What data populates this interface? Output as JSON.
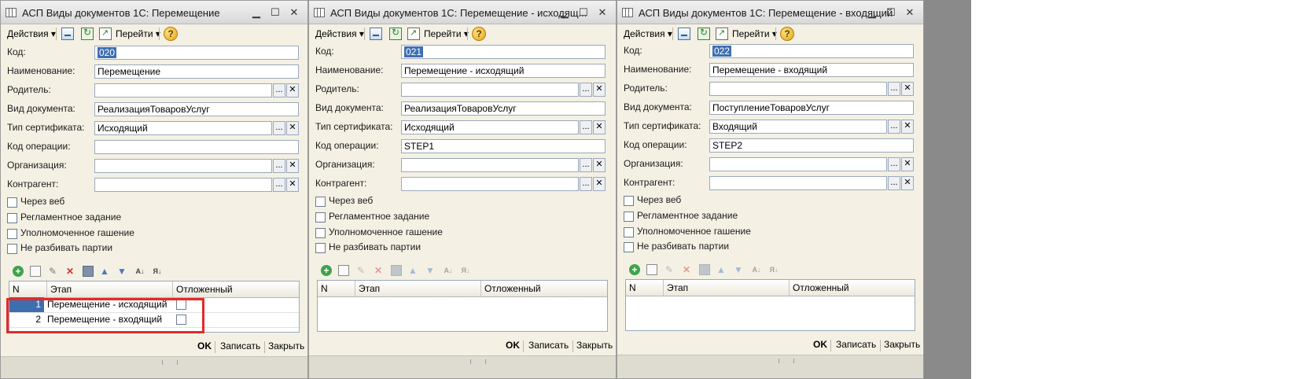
{
  "labels": {
    "code": "Код:",
    "name": "Наименование:",
    "parent": "Родитель:",
    "doc_type": "Вид документа:",
    "cert_type": "Тип сертификата:",
    "op_code": "Код операции:",
    "org": "Организация:",
    "counterparty": "Контрагент:"
  },
  "toolbar": {
    "actions": "Действия ▾",
    "goto": "Перейти ▾",
    "help": "?"
  },
  "checkboxes": {
    "web": "Через веб",
    "scheduled": "Регламентное задание",
    "authorized": "Уполномоченное гашение",
    "no_split": "Не разбивать партии"
  },
  "table_headers": {
    "n": "N",
    "stage": "Этап",
    "deferred": "Отложенный"
  },
  "buttons": {
    "ok": "OK",
    "save": "Записать",
    "close": "Закрыть"
  },
  "field_buttons": {
    "select": "...",
    "clear": "✕"
  },
  "icons": {
    "window": "window-icon",
    "minimize": "▁",
    "maximize": "☐",
    "close": "✕",
    "add": "+",
    "edit": "✎",
    "delete": "✕",
    "up": "▲",
    "down": "▼",
    "sort_az": "A↓",
    "sort_za": "Я↓"
  },
  "windows": [
    {
      "title": "АСП Виды документов 1С: Перемещение",
      "code": "020",
      "name": "Перемещение",
      "parent": "",
      "doc_type": "РеализацияТоваровУслуг",
      "cert_type": "Исходящий",
      "op_code": "",
      "org": "",
      "counterparty": "",
      "rows": [
        {
          "n": "1",
          "stage": "Перемещение - исходящий"
        },
        {
          "n": "2",
          "stage": "Перемещение - входящий"
        }
      ]
    },
    {
      "title": "АСП Виды документов 1С: Перемещение - исходящ...",
      "code": "021",
      "name": "Перемещение - исходящий",
      "parent": "",
      "doc_type": "РеализацияТоваровУслуг",
      "cert_type": "Исходящий",
      "op_code": "STEP1",
      "org": "",
      "counterparty": "",
      "rows": []
    },
    {
      "title": "АСП Виды документов 1С: Перемещение - входящий",
      "code": "022",
      "name": "Перемещение - входящий",
      "parent": "",
      "doc_type": "ПоступлениеТоваровУслуг",
      "cert_type": "Входящий",
      "op_code": "STEP2",
      "org": "",
      "counterparty": "",
      "rows": []
    }
  ],
  "colors": {
    "window_bg": "#f4f1e4",
    "selection": "#3d6fb0",
    "highlight": "#e32a2a"
  }
}
